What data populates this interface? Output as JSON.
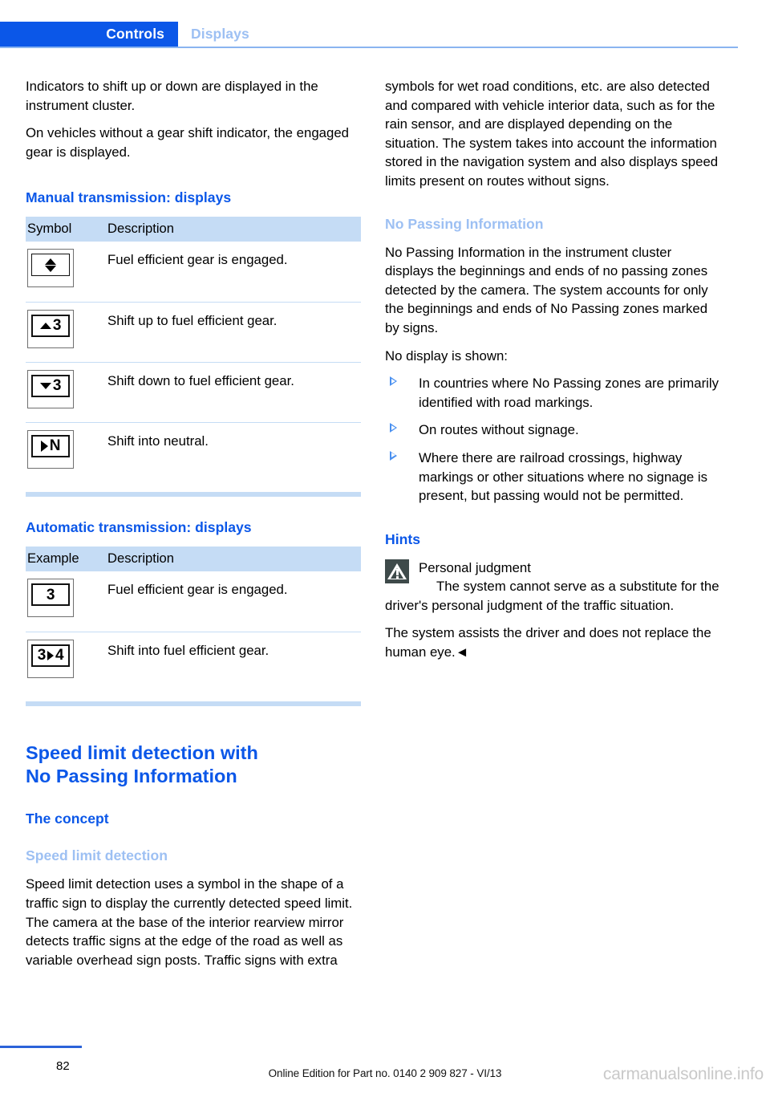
{
  "header": {
    "active_tab": "Controls",
    "inactive_tab": "Displays"
  },
  "left_column": {
    "intro_paragraphs": [
      "Indicators to shift up or down are displayed in the instrument cluster.",
      "On vehicles without a gear shift indicator, the engaged gear is displayed."
    ],
    "manual_heading": "Manual transmission: displays",
    "manual_table": {
      "columns": [
        "Symbol",
        "Description"
      ],
      "rows": [
        {
          "icon": "gear-updown-icon",
          "description": "Fuel efficient gear is engaged."
        },
        {
          "icon": "shift-up-3-icon",
          "description": "Shift up to fuel efficient gear."
        },
        {
          "icon": "shift-down-3-icon",
          "description": "Shift down to fuel efficient gear."
        },
        {
          "icon": "shift-neutral-icon",
          "description": "Shift into neutral."
        }
      ]
    },
    "automatic_heading": "Automatic transmission: displays",
    "automatic_table": {
      "columns": [
        "Example",
        "Description"
      ],
      "rows": [
        {
          "icon": "gear-3-icon",
          "description": "Fuel efficient gear is engaged."
        },
        {
          "icon": "gear-3-to-4-icon",
          "description": "Shift into fuel efficient gear."
        }
      ]
    },
    "main_heading_line1": "Speed limit detection with",
    "main_heading_line2": "No Passing Information",
    "concept_heading": "The concept",
    "speed_limit_heading": "Speed limit detection",
    "speed_limit_paragraph": "Speed limit detection uses a symbol in the shape of a traffic sign to display the currently detected speed limit. The camera at the base of the interior rearview mirror detects traffic signs at the edge of the road as well as variable overhead sign posts. Traffic signs with extra"
  },
  "right_column": {
    "continued_paragraph": "symbols for wet road conditions, etc. are also detected and compared with vehicle interior data, such as for the rain sensor, and are displayed depending on the situation. The system takes into account the information stored in the navigation system and also displays speed limits present on routes without signs.",
    "no_passing_heading": "No Passing Information",
    "no_passing_paragraph": "No Passing Information in the instrument cluster displays the beginnings and ends of no passing zones detected by the camera. The system accounts for only the beginnings and ends of No Passing zones marked by signs.",
    "no_display_lead": "No display is shown:",
    "no_display_bullets": [
      "In countries where No Passing zones are primarily identified with road markings.",
      "On routes without signage.",
      "Where there are railroad crossings, highway markings or other situations where no signage is present, but passing would not be permitted."
    ],
    "hints_heading": "Hints",
    "warning_title": "Personal judgment",
    "warning_body": "The system cannot serve as a substitute for the driver's personal judgment of the traffic situation.",
    "warning_tail": "The system assists the driver and does not replace the human eye.◄"
  },
  "symbol_glyphs": {
    "row2_number": "3",
    "row3_number": "3",
    "row4_letter": "N",
    "auto_row1_number": "3",
    "auto_row2_from": "3",
    "auto_row2_to": "4"
  },
  "footer": {
    "page_number": "82",
    "edition_note": "Online Edition for Part no. 0140 2 909 827 - VI/13",
    "watermark": "carmanualsonline.info"
  },
  "colors": {
    "brand_blue": "#0b57e8",
    "light_blue": "#9dc0f3",
    "table_header_bg": "#c5dcf5",
    "warning_icon_bg": "#3e4a4a"
  }
}
